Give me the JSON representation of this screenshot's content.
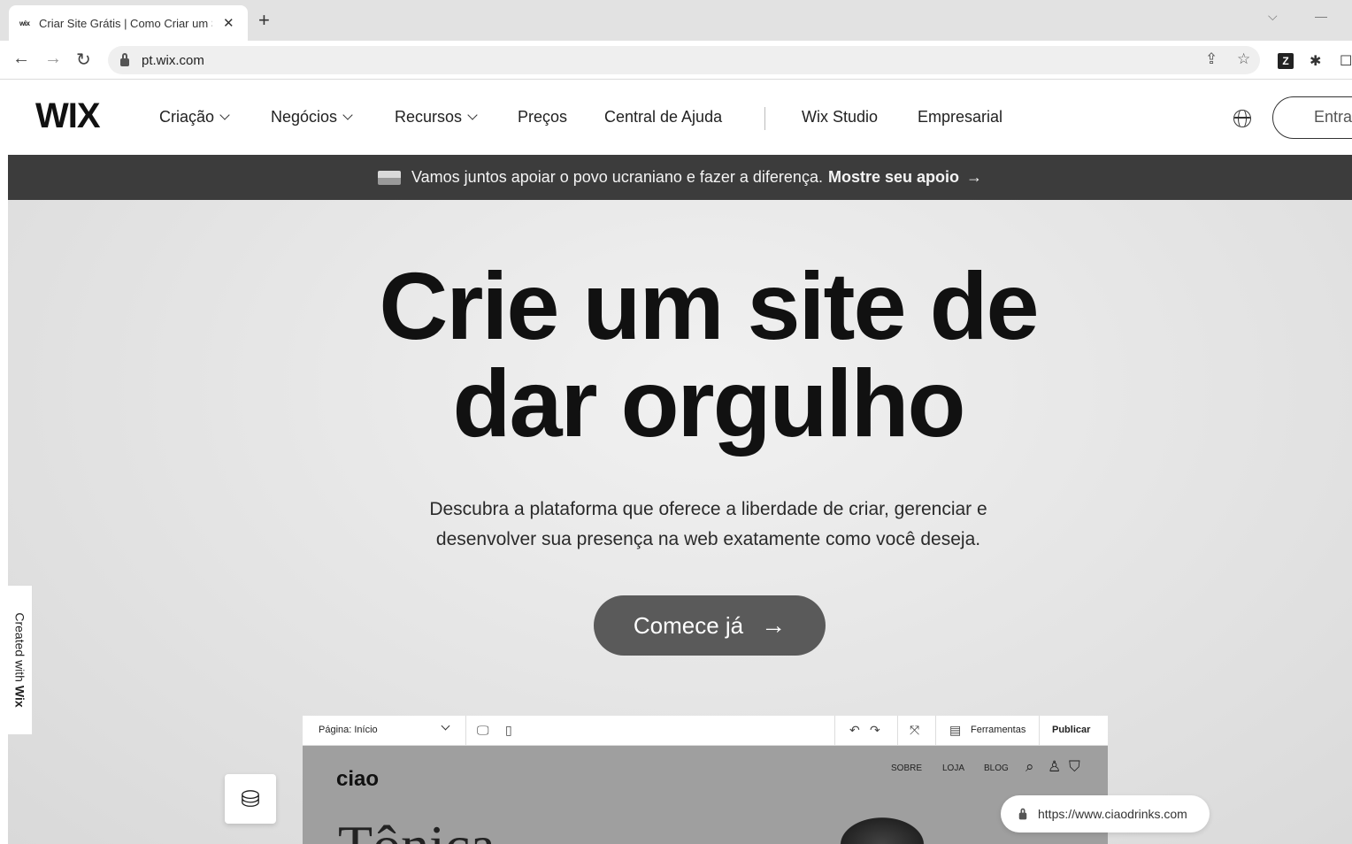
{
  "browser": {
    "tab_favicon": "wix",
    "tab_title": "Criar Site Grátis | Como Criar um Site",
    "tab_close": "✕",
    "new_tab": "+",
    "url": "pt.wix.com"
  },
  "site": {
    "logo": "WIX",
    "menu": {
      "criacao": "Criação",
      "negocios": "Negócios",
      "recursos": "Recursos",
      "precos": "Preços",
      "ajuda": "Central de Ajuda",
      "studio": "Wix Studio",
      "empresarial": "Empresarial"
    },
    "login": "Entrar"
  },
  "banner": {
    "text": "Vamos juntos apoiar o povo ucraniano e fazer a diferença.",
    "link": "Mostre seu apoio",
    "arrow": "→"
  },
  "hero": {
    "title_line1": "Crie um site de",
    "title_line2": "dar orgulho",
    "subtitle_line1": "Descubra a plataforma que oferece a liberdade de criar, gerenciar e",
    "subtitle_line2": "desenvolver sua presença na web exatamente como você deseja.",
    "cta": "Comece já",
    "cta_arrow": "→"
  },
  "side_tab": {
    "text": "Created with",
    "brand": "Wix"
  },
  "editor": {
    "page_select": "Página: Início",
    "tools": "Ferramentas",
    "publish": "Publicar",
    "site_logo": "ciao",
    "nav": [
      "SOBRE",
      "LOJA",
      "BLOG"
    ],
    "hero_text": "Tônica",
    "site_url": "https://www.ciaodrinks.com"
  }
}
